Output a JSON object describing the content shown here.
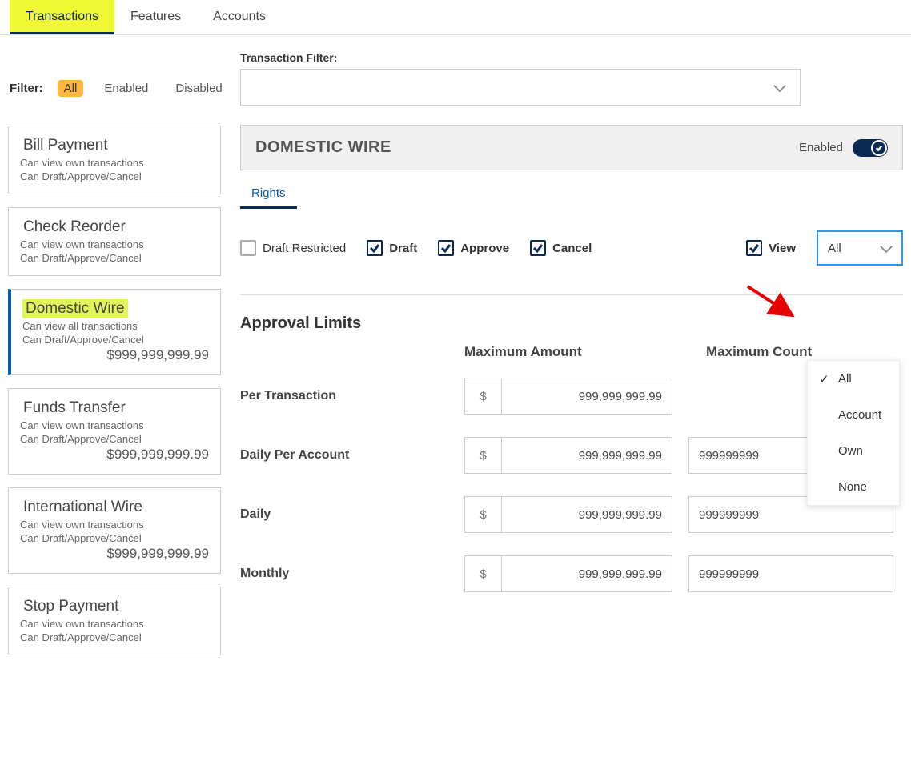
{
  "tabs": {
    "t0": "Transactions",
    "t1": "Features",
    "t2": "Accounts"
  },
  "filter": {
    "label": "Filter:",
    "all": "All",
    "enabled": "Enabled",
    "disabled": "Disabled"
  },
  "cards": [
    {
      "title": "Bill Payment",
      "line1": "Can view own transactions",
      "line2": "Can Draft/Approve/Cancel",
      "amount": ""
    },
    {
      "title": "Check Reorder",
      "line1": "Can view own transactions",
      "line2": "Can Draft/Approve/Cancel",
      "amount": ""
    },
    {
      "title": "Domestic Wire",
      "line1": "Can view all transactions",
      "line2": "Can Draft/Approve/Cancel",
      "amount": "$999,999,999.99"
    },
    {
      "title": "Funds Transfer",
      "line1": "Can view own transactions",
      "line2": "Can Draft/Approve/Cancel",
      "amount": "$999,999,999.99"
    },
    {
      "title": "International Wire",
      "line1": "Can view own transactions",
      "line2": "Can Draft/Approve/Cancel",
      "amount": "$999,999,999.99"
    },
    {
      "title": "Stop Payment",
      "line1": "Can view own transactions",
      "line2": "Can Draft/Approve/Cancel",
      "amount": ""
    }
  ],
  "trfilter": {
    "label": "Transaction Filter:"
  },
  "panel": {
    "title": "DOMESTIC WIRE",
    "enabled": "Enabled"
  },
  "subtab": {
    "rights": "Rights"
  },
  "rights": {
    "draft_restricted": "Draft Restricted",
    "draft": "Draft",
    "approve": "Approve",
    "cancel": "Cancel",
    "view": "View",
    "view_value": "All"
  },
  "dropdown": {
    "o0": "All",
    "o1": "Account",
    "o2": "Own",
    "o3": "None"
  },
  "limits": {
    "title": "Approval Limits",
    "h_amount": "Maximum Amount",
    "h_count": "Maximum Count",
    "currency": "$",
    "rows": {
      "r0": {
        "label": "Per Transaction",
        "amount": "999,999,999.99",
        "count": ""
      },
      "r1": {
        "label": "Daily Per Account",
        "amount": "999,999,999.99",
        "count": "999999999"
      },
      "r2": {
        "label": "Daily",
        "amount": "999,999,999.99",
        "count": "999999999"
      },
      "r3": {
        "label": "Monthly",
        "amount": "999,999,999.99",
        "count": "999999999"
      }
    }
  }
}
